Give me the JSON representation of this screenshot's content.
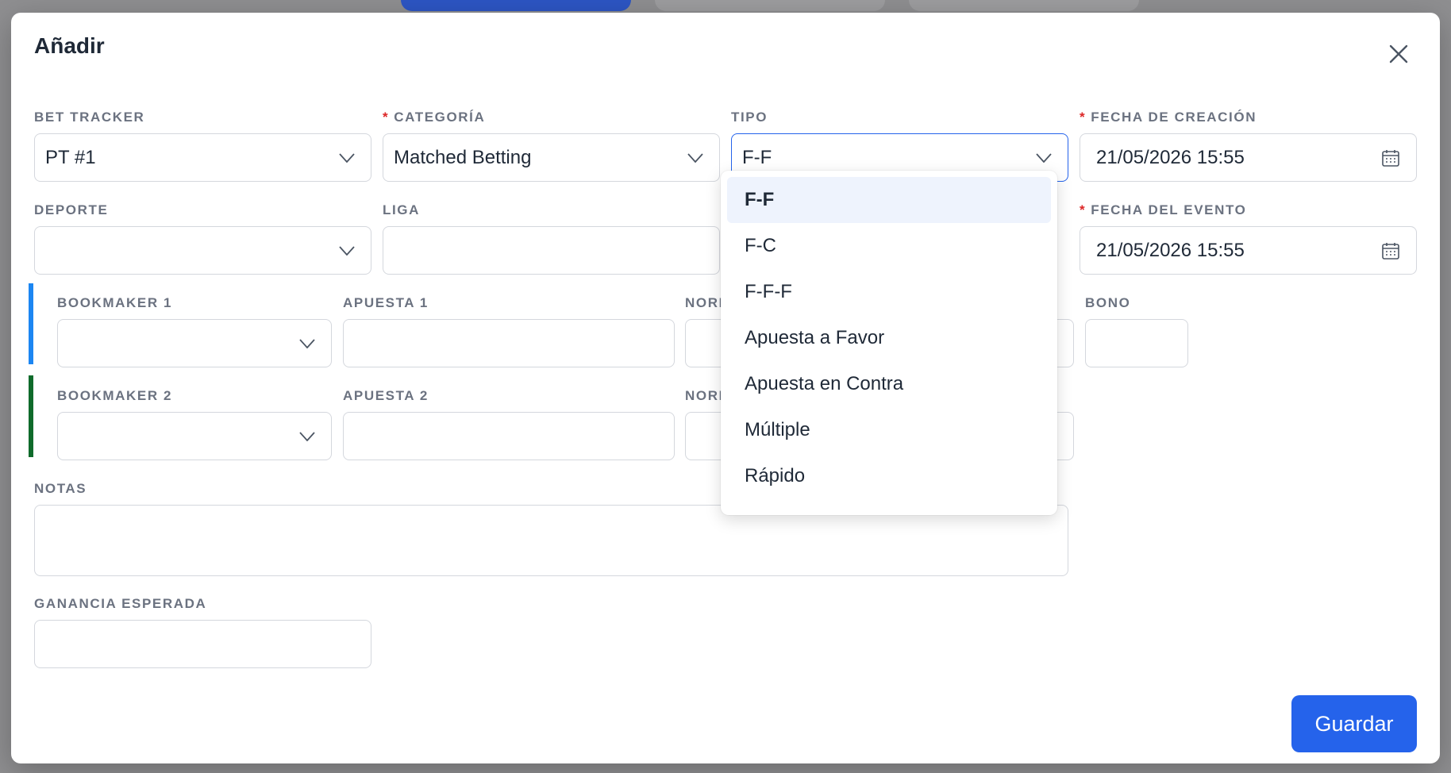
{
  "modal": {
    "title": "Añadir",
    "save_label": "Guardar"
  },
  "fields": {
    "bet_tracker": {
      "label": "BET TRACKER",
      "value": "PT #1"
    },
    "categoria": {
      "required_mark": "*",
      "label": "CATEGORÍA",
      "value": "Matched Betting"
    },
    "tipo": {
      "label": "TIPO",
      "value": "F-F"
    },
    "fecha_creacion": {
      "required_mark": "*",
      "label": "FECHA DE CREACIÓN",
      "value": "21/05/2026 15:55"
    },
    "deporte": {
      "label": "DEPORTE",
      "value": ""
    },
    "liga": {
      "label": "LIGA",
      "value": ""
    },
    "fecha_evento": {
      "required_mark": "*",
      "label": "FECHA DEL EVENTO",
      "value": "21/05/2026 15:55"
    },
    "bookmaker1": {
      "label": "BOOKMAKER 1",
      "value": ""
    },
    "apuesta1": {
      "label": "APUESTA 1",
      "value": ""
    },
    "norm1": {
      "label": "NORM",
      "value": ""
    },
    "bono": {
      "label": "BONO",
      "value": ""
    },
    "bookmaker2": {
      "label": "BOOKMAKER 2",
      "value": ""
    },
    "apuesta2": {
      "label": "APUESTA 2",
      "value": ""
    },
    "norm2": {
      "label": "NORM",
      "value": ""
    },
    "notas": {
      "label": "NOTAS",
      "value": ""
    },
    "ganancia": {
      "label": "GANANCIA ESPERADA",
      "value": ""
    }
  },
  "tipo_dropdown": {
    "options": [
      "F-F",
      "F-C",
      "F-F-F",
      "Apuesta a Favor",
      "Apuesta en Contra",
      "Múltiple",
      "Rápido"
    ],
    "selected": "F-F"
  },
  "colors": {
    "accent": "#2563eb",
    "bookmaker1_bar": "#1c86f2",
    "bookmaker2_bar": "#0f6b2b",
    "required": "#dc2626"
  },
  "icons": {
    "close": "close-icon",
    "chevron": "chevron-down-icon",
    "calendar": "calendar-icon"
  }
}
